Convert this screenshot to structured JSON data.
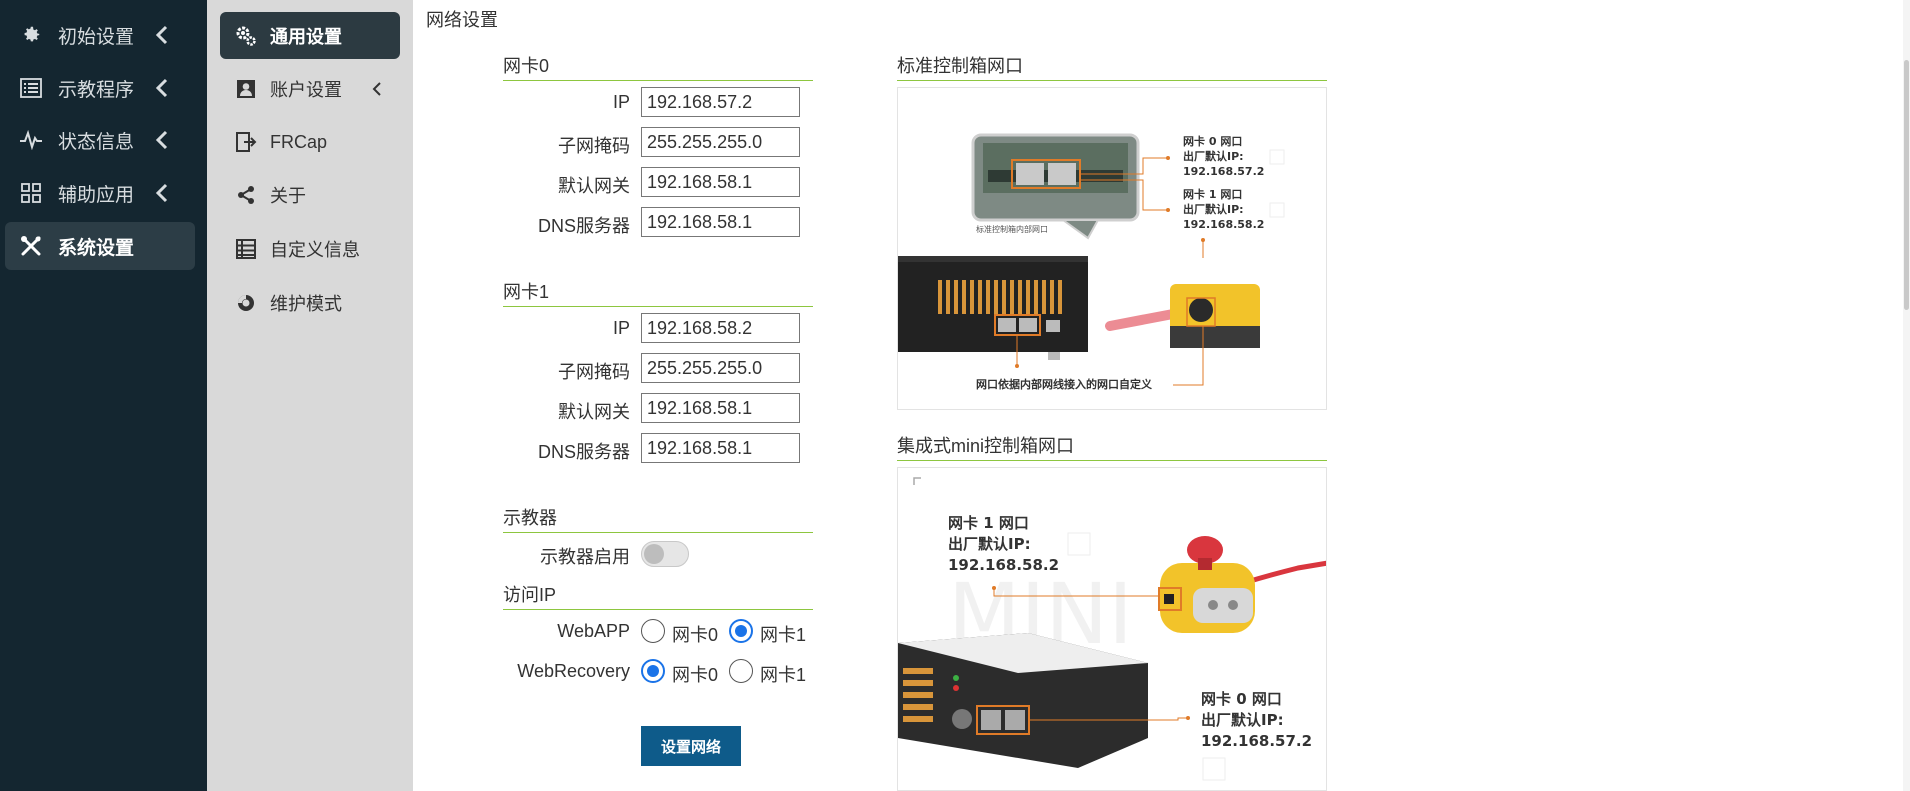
{
  "nav_main": {
    "items": [
      {
        "label": "初始设置",
        "icon": "gear-icon"
      },
      {
        "label": "示教程序",
        "icon": "list-icon"
      },
      {
        "label": "状态信息",
        "icon": "pulse-icon"
      },
      {
        "label": "辅助应用",
        "icon": "grid-icon"
      },
      {
        "label": "系统设置",
        "icon": "tools-icon",
        "active": true
      }
    ]
  },
  "nav_sub": {
    "items": [
      {
        "label": "通用设置",
        "icon": "gears-icon",
        "active": true
      },
      {
        "label": "账户设置",
        "icon": "account-icon"
      },
      {
        "label": "FRCap",
        "icon": "frcap-icon"
      },
      {
        "label": "关于",
        "icon": "share-icon"
      },
      {
        "label": "自定义信息",
        "icon": "table-icon"
      },
      {
        "label": "维护模式",
        "icon": "maintenance-icon"
      }
    ]
  },
  "page": {
    "title": "网络设置"
  },
  "nic0": {
    "title": "网卡0",
    "ip_label": "IP",
    "ip": "192.168.57.2",
    "mask_label": "子网掩码",
    "mask": "255.255.255.0",
    "gateway_label": "默认网关",
    "gateway": "192.168.58.1",
    "dns_label": "DNS服务器",
    "dns": "192.168.58.1"
  },
  "nic1": {
    "title": "网卡1",
    "ip_label": "IP",
    "ip": "192.168.58.2",
    "mask_label": "子网掩码",
    "mask": "255.255.255.0",
    "gateway_label": "默认网关",
    "gateway": "192.168.58.1",
    "dns_label": "DNS服务器",
    "dns": "192.168.58.1"
  },
  "teach_pendant": {
    "title": "示教器",
    "enable_label": "示教器启用",
    "enabled": false
  },
  "access_ip": {
    "title": "访问IP",
    "webapp_label": "WebAPP",
    "webrecovery_label": "WebRecovery",
    "opt_nic0": "网卡0",
    "opt_nic1": "网卡1",
    "webapp_selected": "网卡1",
    "webrecovery_selected": "网卡0"
  },
  "actions": {
    "set_network": "设置网络"
  },
  "std_box": {
    "title": "标准控制箱网口",
    "inner_caption": "标准控制箱内部网口",
    "nic0_line1": "网卡 0 网口",
    "nic0_line2": "出厂默认IP:",
    "nic0_line3": "192.168.57.2",
    "nic1_line1": "网卡 1 网口",
    "nic1_line2": "出厂默认IP:",
    "nic1_line3": "192.168.58.2",
    "bottom_note": "网口依据内部网线接入的网口自定义"
  },
  "mini_box": {
    "title": "集成式mini控制箱网口",
    "watermark": "MINI",
    "nic1_line1": "网卡 1 网口",
    "nic1_line2": "出厂默认IP:",
    "nic1_line3": "192.168.58.2",
    "nic0_line1": "网卡 0 网口",
    "nic0_line2": "出厂默认IP:",
    "nic0_line3": "192.168.57.2"
  },
  "colors": {
    "sidebar_bg": "#142630",
    "subnav_bg": "#d9d9d9",
    "accent_line": "#8dc63f",
    "button_bg": "#0e5b8a",
    "radio_blue": "#1a73e8",
    "annotation_orange": "#e07b28"
  }
}
